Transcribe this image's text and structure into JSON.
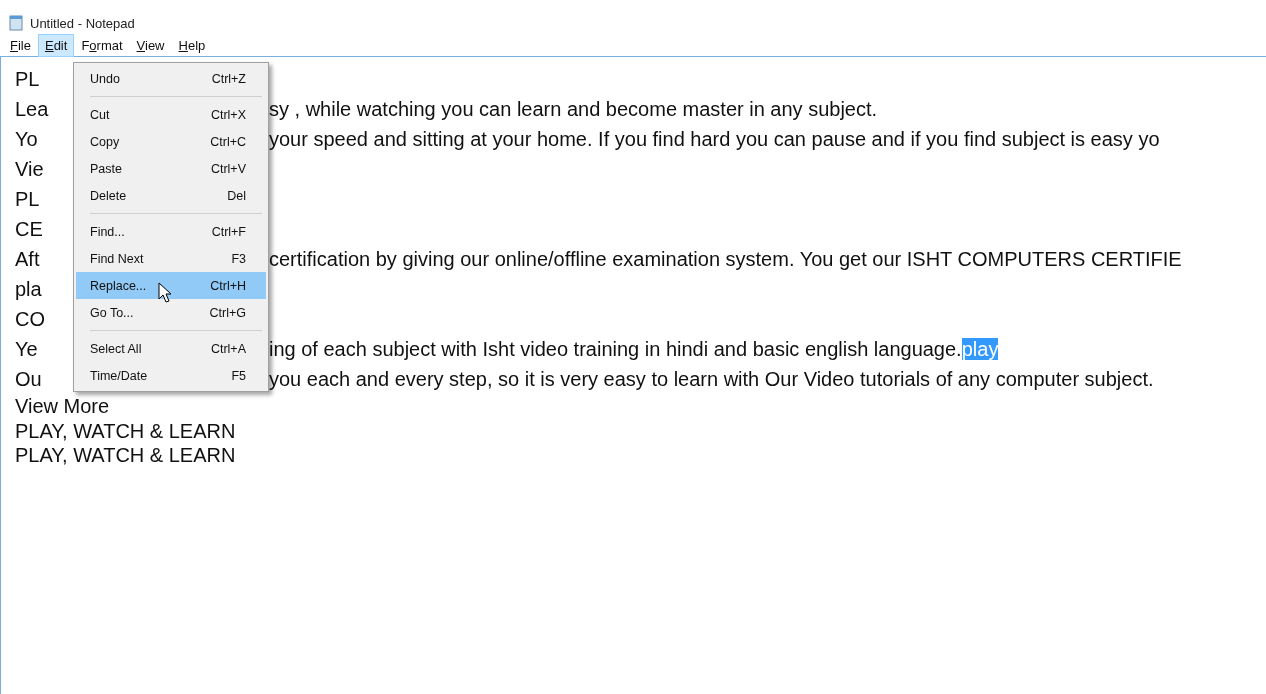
{
  "window": {
    "title": "Untitled - Notepad"
  },
  "menu_bar": [
    {
      "access_key": "F",
      "label_rest": "ile",
      "selected": false
    },
    {
      "access_key": "E",
      "label_rest": "dit",
      "selected": true
    },
    {
      "label_start": "F",
      "access_key": "o",
      "label_rest": "rmat",
      "selected": false
    },
    {
      "access_key": "V",
      "label_rest": "iew",
      "selected": false
    },
    {
      "access_key": "H",
      "label_rest": "elp",
      "selected": false
    }
  ],
  "edit_menu": [
    {
      "kind": "item",
      "label": "Undo",
      "shortcut": "Ctrl+Z",
      "selected": false
    },
    {
      "kind": "separator"
    },
    {
      "kind": "item",
      "label": "Cut",
      "shortcut": "Ctrl+X",
      "selected": false
    },
    {
      "kind": "item",
      "label": "Copy",
      "shortcut": "Ctrl+C",
      "selected": false
    },
    {
      "kind": "item",
      "label": "Paste",
      "shortcut": "Ctrl+V",
      "selected": false
    },
    {
      "kind": "item",
      "label": "Delete",
      "shortcut": "Del",
      "selected": false
    },
    {
      "kind": "separator"
    },
    {
      "kind": "item",
      "label": "Find...",
      "shortcut": "Ctrl+F",
      "selected": false
    },
    {
      "kind": "item",
      "label": "Find Next",
      "shortcut": "F3",
      "selected": false
    },
    {
      "kind": "item",
      "label": "Replace...",
      "shortcut": "Ctrl+H",
      "selected": true
    },
    {
      "kind": "item",
      "label": "Go To...",
      "shortcut": "Ctrl+G",
      "selected": false
    },
    {
      "kind": "separator"
    },
    {
      "kind": "item",
      "label": "Select All",
      "shortcut": "Ctrl+A",
      "selected": false
    },
    {
      "kind": "item",
      "label": "Time/Date",
      "shortcut": "F5",
      "selected": false
    }
  ],
  "document_lines": [
    {
      "kind": "split",
      "left": "PL"
    },
    {
      "kind": "split",
      "left": "Lea",
      "right": "sy , while watching you can learn and become master in any subject."
    },
    {
      "kind": "split",
      "left": "Yo",
      "right": "your speed and sitting at your home. If you find hard you can pause and if you find subject is easy yo"
    },
    {
      "kind": "split",
      "left": "Vie"
    },
    {
      "kind": "split",
      "left": "PL"
    },
    {
      "kind": "split",
      "left": "CE"
    },
    {
      "kind": "split",
      "left": "Aft",
      "right": "certification by giving our online/offline examination system. You get our ISHT COMPUTERS CERTIFIE"
    },
    {
      "kind": "split",
      "left": "pla"
    },
    {
      "kind": "split",
      "left": "CO"
    },
    {
      "kind": "split",
      "left": "Ye",
      "right": "ing of each subject with Isht video training in hindi and basic english language.",
      "selection": "play"
    },
    {
      "kind": "split",
      "left": "Ou",
      "right": "you each and every step, so it is very easy to learn with Our Video tutorials of any computer subject."
    },
    {
      "kind": "full",
      "text": "View More"
    },
    {
      "kind": "full",
      "text": "PLAY, WATCH & LEARN"
    },
    {
      "kind": "full",
      "text": "PLAY, WATCH & LEARN"
    }
  ]
}
